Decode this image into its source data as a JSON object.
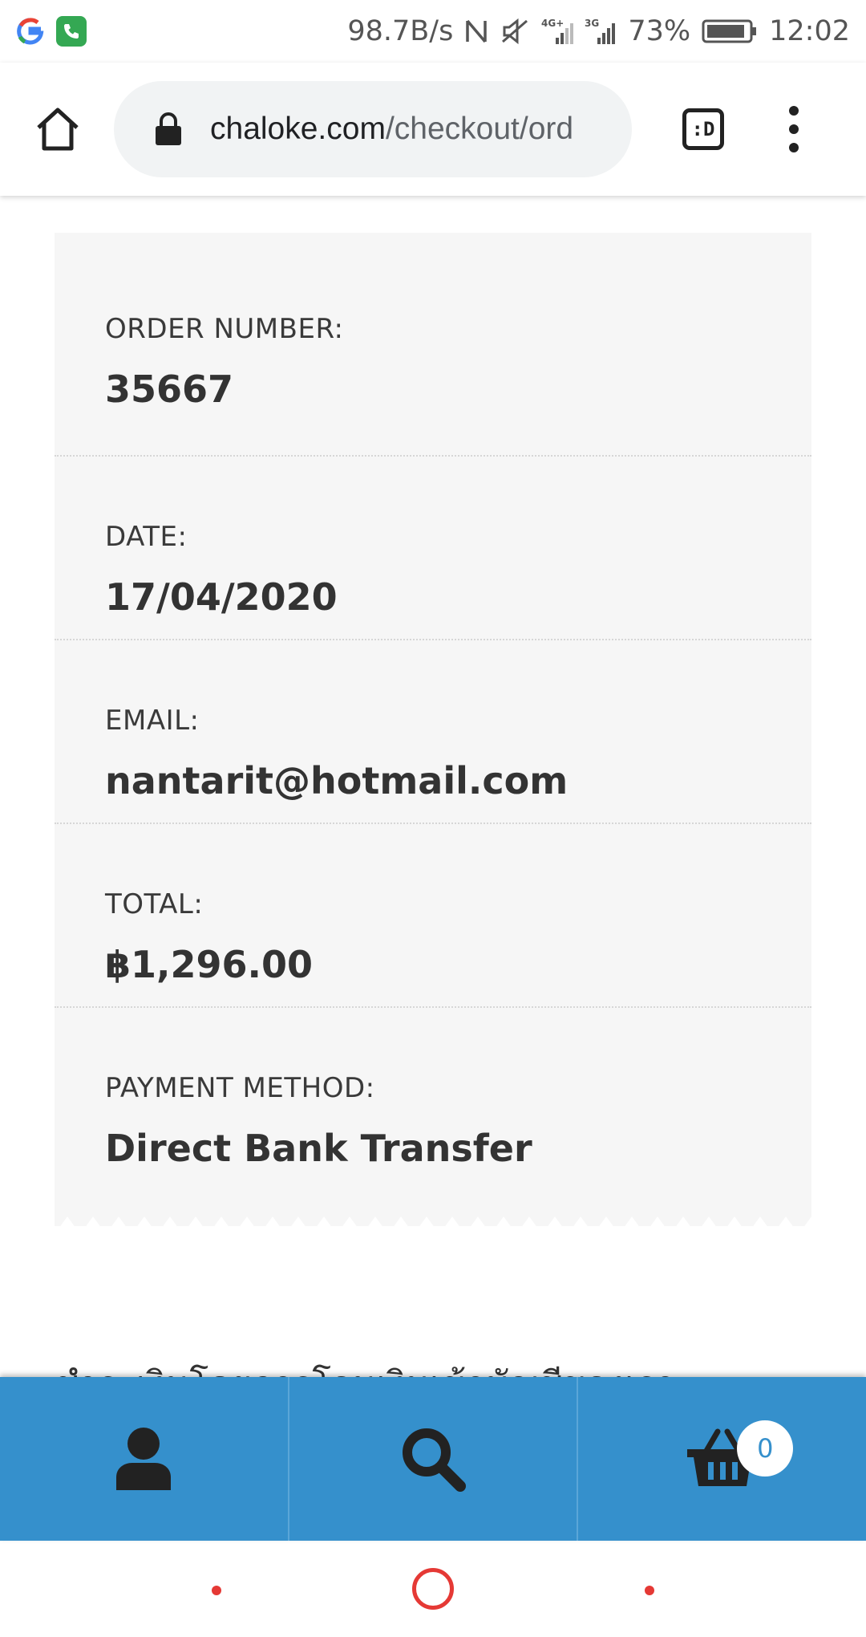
{
  "status_bar": {
    "net_speed": "98.7B/s",
    "signal_4g": "4G+",
    "signal_3g": "3G",
    "battery": "73%",
    "time": "12:02"
  },
  "browser": {
    "url_domain": "chaloke.com",
    "url_path": "/checkout/ord",
    "extension_label": ":D"
  },
  "order": {
    "number_label": "ORDER NUMBER:",
    "number": "35667",
    "date_label": "DATE:",
    "date": "17/04/2020",
    "email_label": "EMAIL:",
    "email": "nantarit@hotmail.com",
    "total_label": "TOTAL:",
    "total": "฿1,296.00",
    "payment_label": "PAYMENT METHOD:",
    "payment": "Direct Bank Transfer"
  },
  "partial_text": "ชำระเงินโดยการโอนเงินเข้าบัญชีของเรา :",
  "bottom_nav": {
    "cart_count": "0"
  },
  "colors": {
    "nav_blue": "#3590cc",
    "receipt_bg": "#f6f6f6",
    "system_red": "#e53935"
  }
}
